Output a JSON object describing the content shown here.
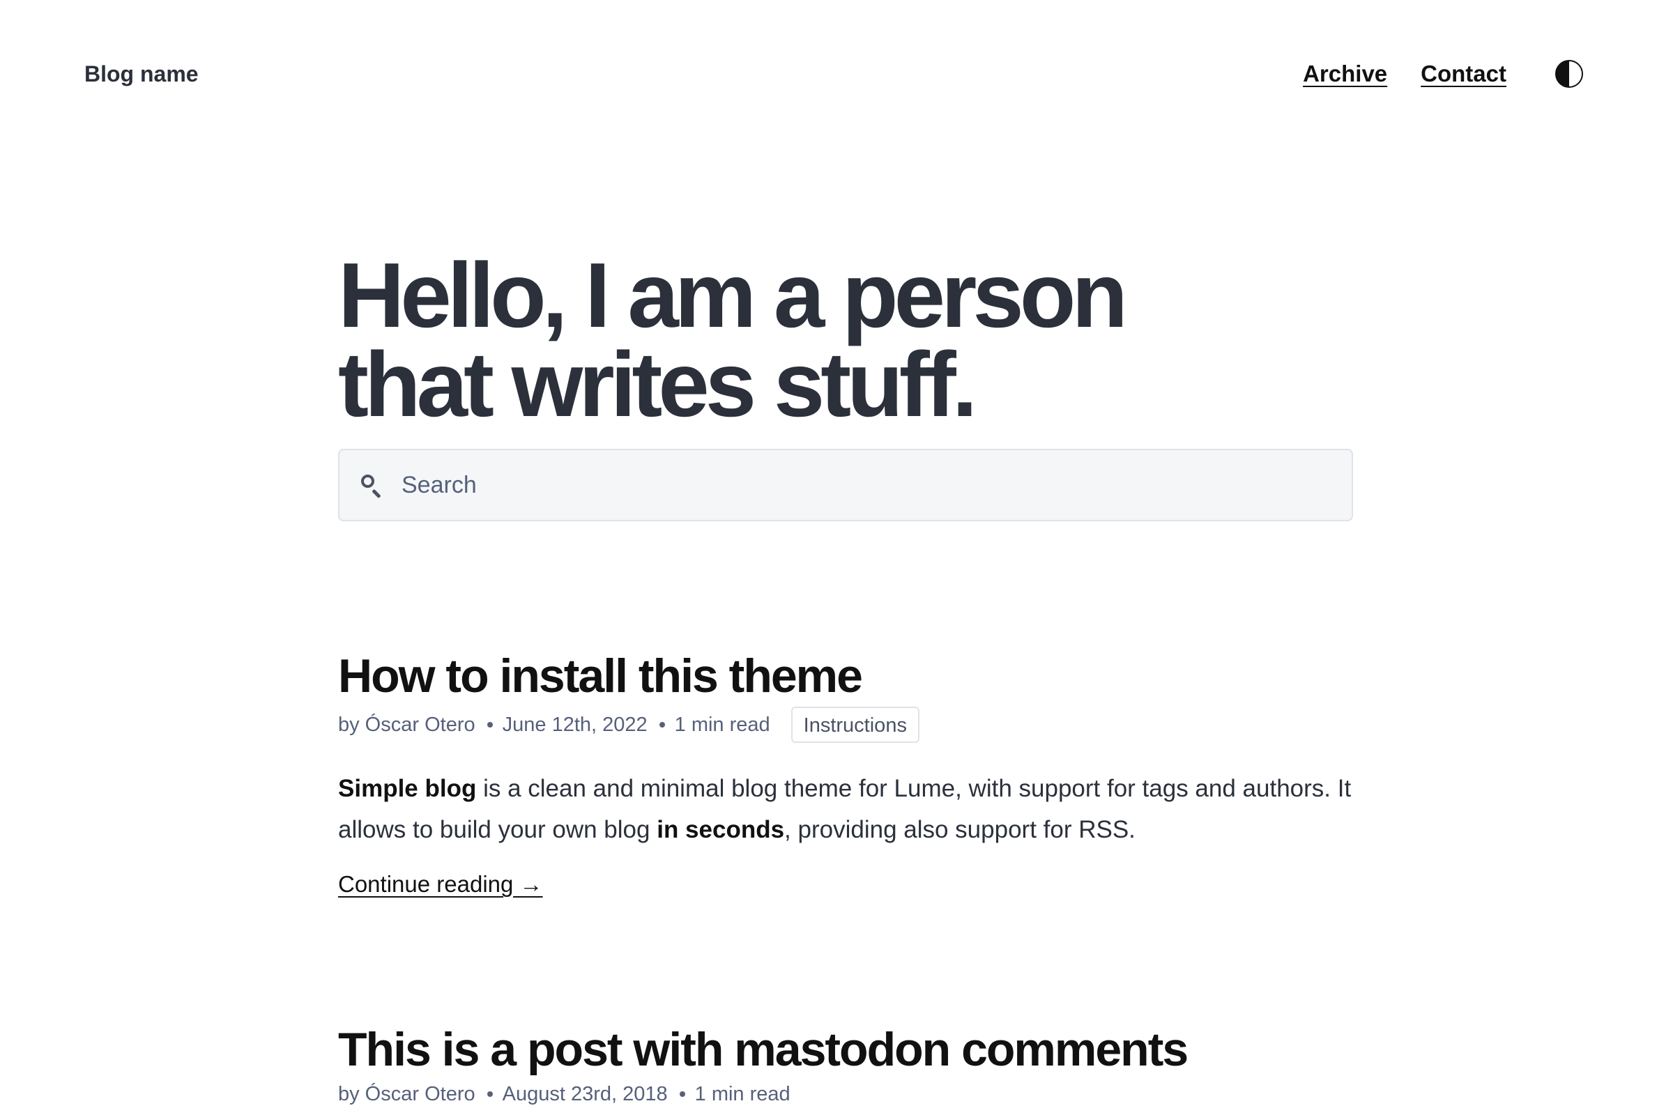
{
  "header": {
    "blog_name": "Blog name",
    "nav": {
      "archive": "Archive",
      "contact": "Contact"
    },
    "theme_toggle_icon": "half-circle-icon"
  },
  "hero": {
    "line1": "Hello, I am a person",
    "line2": "that writes stuff."
  },
  "search": {
    "placeholder": "Search",
    "icon": "search-icon"
  },
  "posts": [
    {
      "title": "How to install this theme",
      "author": "by Óscar Otero",
      "date": "June 12th, 2022",
      "read_time": "1 min read",
      "tag": "Instructions",
      "excerpt": {
        "bold1": "Simple blog",
        "text1": " is a clean and minimal blog theme for Lume, with support for tags and authors. It allows to build your own blog ",
        "bold2": "in seconds",
        "text2": ", providing also support for RSS."
      },
      "continue_label": "Continue reading →"
    },
    {
      "title": "This is a post with mastodon comments",
      "author": "by Óscar Otero",
      "date": "August 23rd, 2018",
      "read_time": "1 min read"
    }
  ]
}
